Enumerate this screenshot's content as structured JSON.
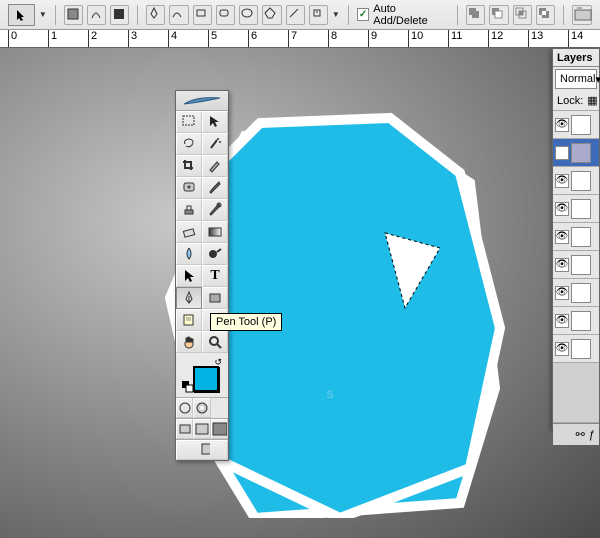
{
  "options_bar": {
    "auto_add_delete_label": "Auto Add/Delete",
    "auto_add_delete_checked": true
  },
  "ruler": {
    "marks": [
      0,
      1,
      2,
      3,
      4,
      5,
      6,
      7,
      8,
      9,
      10,
      11,
      12,
      13,
      14
    ]
  },
  "toolbox": {
    "tools": [
      {
        "name": "marquee",
        "icon": "rect-select"
      },
      {
        "name": "move",
        "icon": "move"
      },
      {
        "name": "lasso",
        "icon": "lasso"
      },
      {
        "name": "magic-wand",
        "icon": "wand"
      },
      {
        "name": "crop",
        "icon": "crop"
      },
      {
        "name": "slice",
        "icon": "slice"
      },
      {
        "name": "healing",
        "icon": "patch"
      },
      {
        "name": "brush",
        "icon": "brush"
      },
      {
        "name": "stamp",
        "icon": "stamp"
      },
      {
        "name": "history-brush",
        "icon": "history"
      },
      {
        "name": "eraser",
        "icon": "eraser"
      },
      {
        "name": "gradient",
        "icon": "gradient"
      },
      {
        "name": "blur",
        "icon": "blur"
      },
      {
        "name": "dodge",
        "icon": "dodge"
      },
      {
        "name": "path-select",
        "icon": "arrow"
      },
      {
        "name": "type",
        "icon": "T"
      },
      {
        "name": "pen",
        "icon": "pen",
        "active": true
      },
      {
        "name": "shape",
        "icon": "rect"
      },
      {
        "name": "notes",
        "icon": "note"
      },
      {
        "name": "eyedropper",
        "icon": "dropper"
      },
      {
        "name": "hand",
        "icon": "hand"
      },
      {
        "name": "zoom",
        "icon": "zoom"
      }
    ],
    "foreground_color": "#00b4e6",
    "background_color": "#ffffff"
  },
  "tooltip": {
    "text": "Pen Tool (P)"
  },
  "layers": {
    "tab_label": "Layers",
    "blend_mode": "Normal",
    "lock_label": "Lock:",
    "layers": [
      {
        "visible": true,
        "active": false,
        "has_shape": true
      },
      {
        "visible": true,
        "active": true,
        "has_shape": true
      },
      {
        "visible": true,
        "active": false
      },
      {
        "visible": true,
        "active": false
      },
      {
        "visible": true,
        "active": false
      },
      {
        "visible": true,
        "active": false
      },
      {
        "visible": true,
        "active": false
      },
      {
        "visible": true,
        "active": false
      },
      {
        "visible": true,
        "active": false
      }
    ]
  },
  "canvas": {
    "main_fill": "#1fbce8",
    "outline": "#ffffff",
    "s_fill": "#5ec9e9"
  }
}
